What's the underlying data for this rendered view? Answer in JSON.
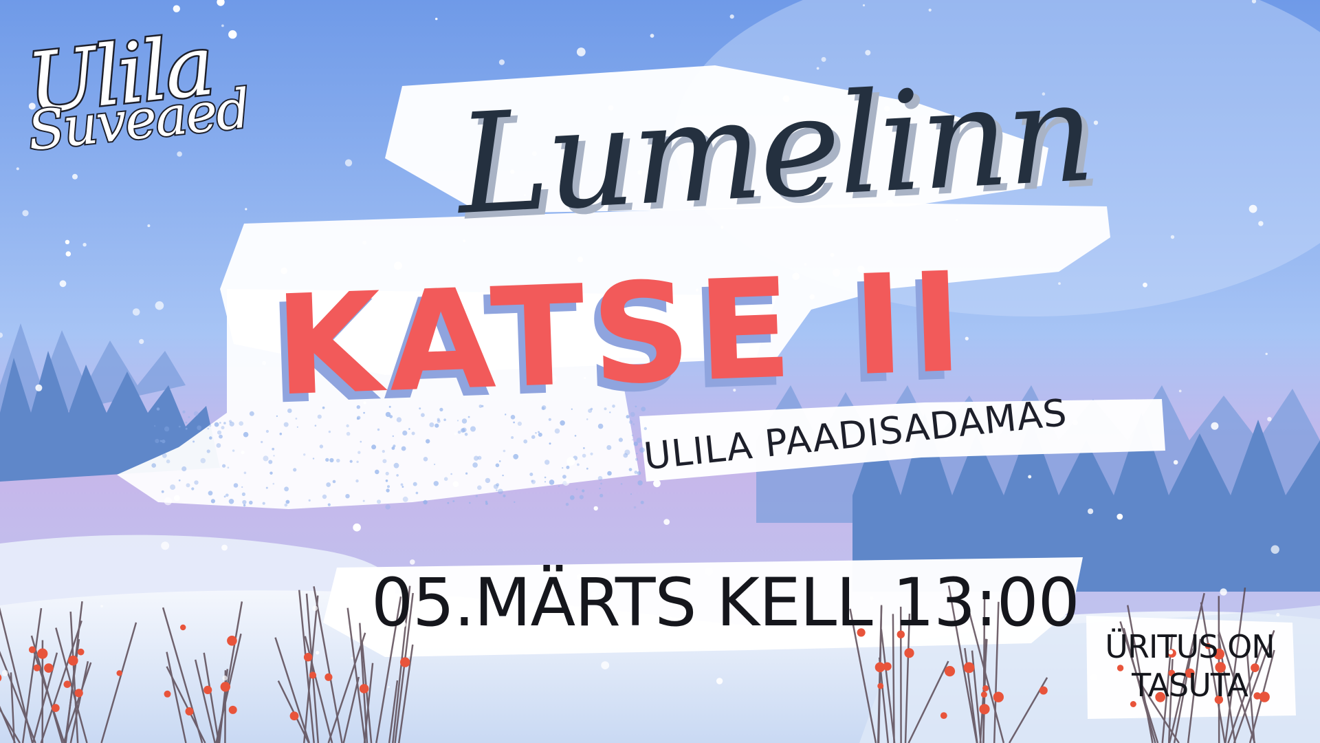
{
  "logo": {
    "line1": "Ulila",
    "line2": "Suveaed"
  },
  "event": {
    "title": "Lumelinn",
    "subtitle": "KATSE II",
    "venue": "ULILA PAADISADAMAS",
    "datetime": "05.MÄRTS KELL 13:00"
  },
  "note": {
    "line1": "ÜRITUS ON",
    "line2": "TASUTA"
  },
  "colors": {
    "sky_top": "#6f9ae8",
    "sky_mid": "#a7c4f5",
    "horizon_haze": "#c7b6ea",
    "forest": "#5f87c9",
    "snow": "#eef3fb",
    "brush_white": "#ffffff",
    "title_dark": "#24303f",
    "accent_red": "#f25a5a",
    "shadow_blue": "#8fa4de",
    "berry_red": "#e8543b"
  }
}
